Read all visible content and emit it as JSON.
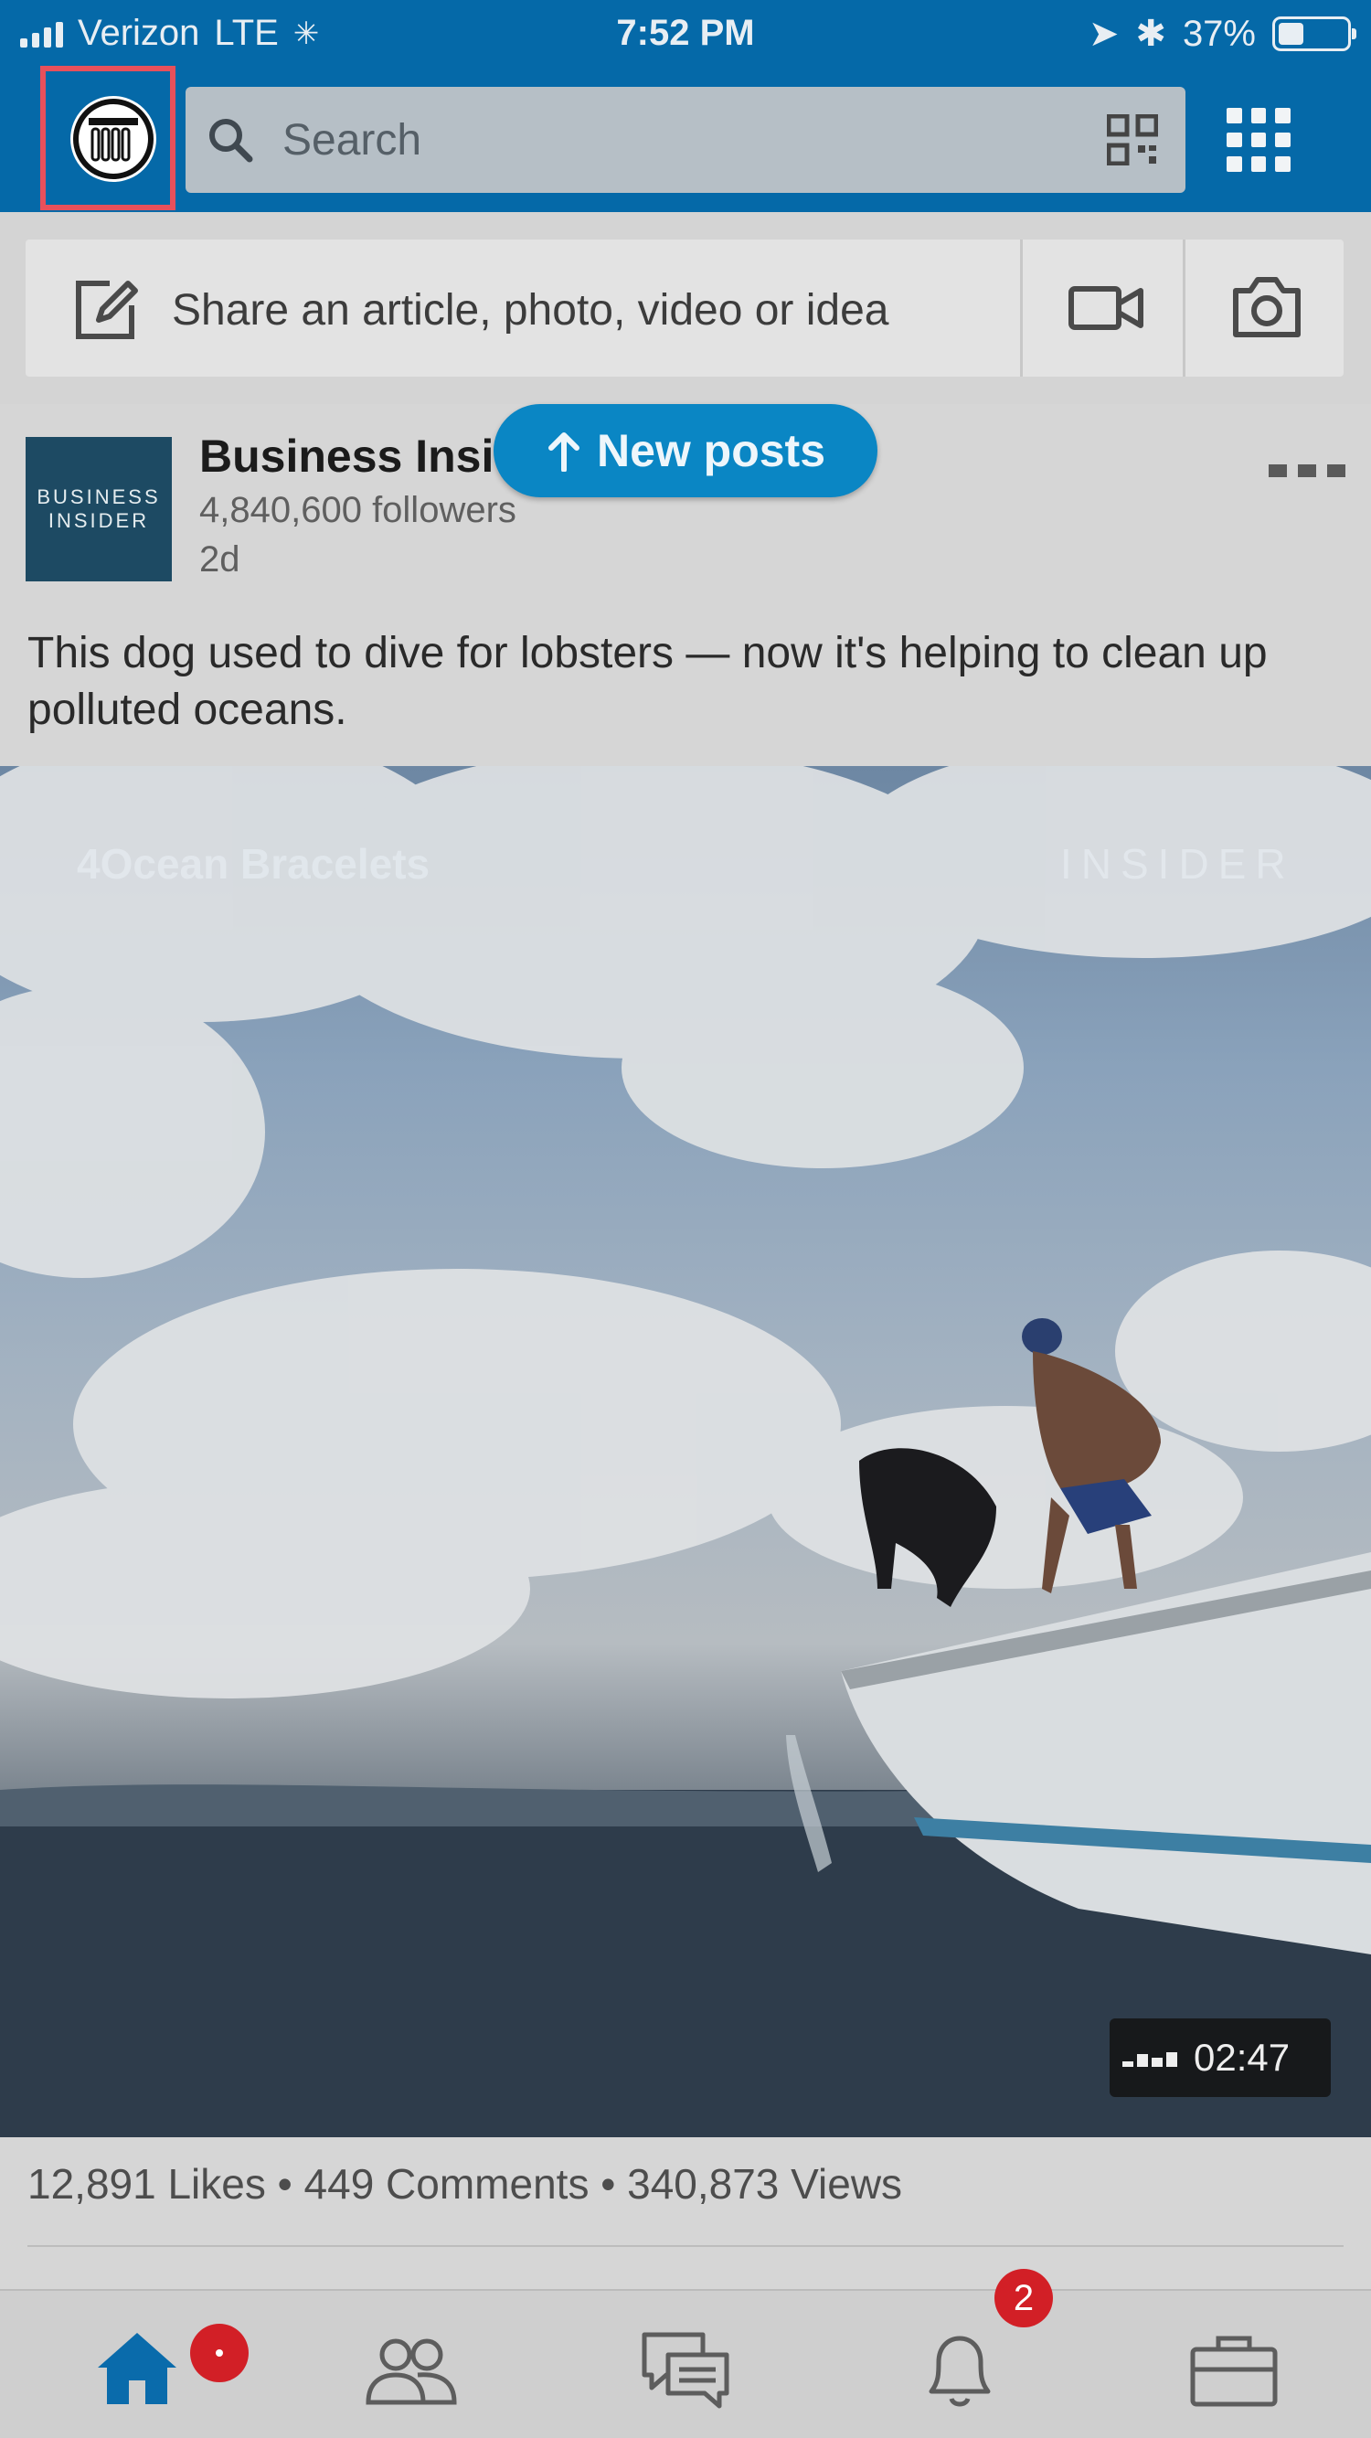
{
  "status": {
    "carrier": "Verizon",
    "network": "LTE",
    "time": "7:52 PM",
    "battery": "37%"
  },
  "header": {
    "search_placeholder": "Search"
  },
  "share": {
    "prompt": "Share an article, photo, video or idea"
  },
  "new_posts": {
    "label": "New posts"
  },
  "post": {
    "author": "Business Insider",
    "logo_text_line1": "BUSINESS",
    "logo_text_line2": "INSIDER",
    "followers": "4,840,600 followers",
    "age": "2d",
    "caption": "This dog used to dive for lobsters — now it's helping to clean up polluted oceans.",
    "watermark_left": "4Ocean Bracelets",
    "watermark_right": "INSIDER",
    "duration": "02:47",
    "stats": "12,891 Likes • 449 Comments • 340,873 Views"
  },
  "nav": {
    "notifications_badge": "2",
    "home_badge": ""
  },
  "colors": {
    "brand_blue": "#0569a8",
    "badge_red": "#d21f26",
    "pill_blue": "#0a86c4"
  }
}
